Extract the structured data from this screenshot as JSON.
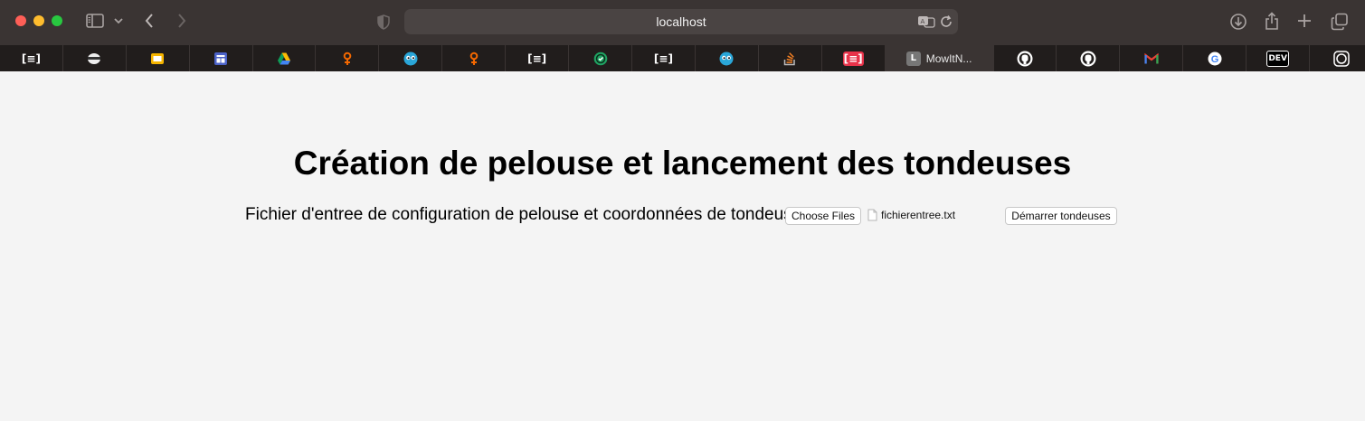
{
  "browser": {
    "address": "localhost",
    "active_tab_label": "MowItN...",
    "active_tab_letter": "L",
    "tabs": [
      {
        "icon": "reader-icon",
        "glyph": "[≡]"
      },
      {
        "icon": "mask-icon",
        "glyph": ""
      },
      {
        "icon": "slides-icon",
        "glyph": ""
      },
      {
        "icon": "board-icon",
        "glyph": ""
      },
      {
        "icon": "drive-icon",
        "glyph": ""
      },
      {
        "icon": "grafana-icon",
        "glyph": ""
      },
      {
        "icon": "eyes-icon",
        "glyph": ""
      },
      {
        "icon": "grafana-icon",
        "glyph": ""
      },
      {
        "icon": "reader-icon",
        "glyph": "[≡]"
      },
      {
        "icon": "round-green-icon",
        "glyph": ""
      },
      {
        "icon": "reader-icon",
        "glyph": "[≡]"
      },
      {
        "icon": "eyes-icon",
        "glyph": ""
      },
      {
        "icon": "stackoverflow-icon",
        "glyph": ""
      },
      {
        "icon": "red-reader-icon",
        "glyph": "[≡]"
      },
      {
        "icon": "active",
        "glyph": ""
      },
      {
        "icon": "github-icon",
        "glyph": ""
      },
      {
        "icon": "github-icon",
        "glyph": ""
      },
      {
        "icon": "gmail-icon",
        "glyph": ""
      },
      {
        "icon": "google-icon",
        "glyph": ""
      },
      {
        "icon": "dev-icon",
        "glyph": "DEV"
      },
      {
        "icon": "circle-icon",
        "glyph": ""
      }
    ]
  },
  "page": {
    "title": "Création de pelouse et lancement des tondeuses",
    "file_label": "Fichier d'entree de configuration de pelouse et coordonnées de tondeuses:",
    "choose_button": "Choose Files",
    "file_name": "fichierentree.txt",
    "start_button": "Démarrer tondeuses"
  },
  "colors": {
    "titlebar": "#3a3433",
    "tabbar": "#211d1c",
    "page_bg": "#f4f4f4",
    "close": "#fe5f57",
    "minimize": "#febc2e",
    "zoom": "#28c840"
  }
}
